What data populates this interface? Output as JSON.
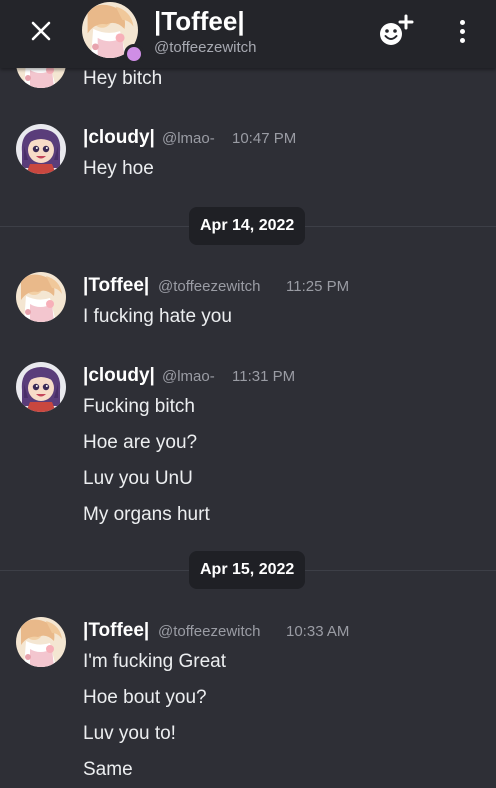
{
  "header": {
    "name": "|Toffee|",
    "handle": "@toffeezewitch",
    "status_color": "#cf8ee6",
    "icons": [
      "close-icon",
      "add-friend-icon",
      "more-vertical-icon"
    ]
  },
  "messages": [
    {
      "text": "Hey bitch"
    },
    {
      "author": "|cloudy|",
      "handle": "@lmao-",
      "time": "10:47 PM",
      "lines": [
        "Hey hoe"
      ]
    },
    {
      "date": "Apr 14, 2022"
    },
    {
      "author": "|Toffee|",
      "handle": "@toffeezewitch",
      "time": "11:25 PM",
      "lines": [
        "I fucking hate you"
      ]
    },
    {
      "author": "|cloudy|",
      "handle": "@lmao-",
      "time": "11:31 PM",
      "lines": [
        "Fucking bitch",
        "Hoe are you?",
        "Luv you UnU",
        "My organs hurt"
      ]
    },
    {
      "date": "Apr 15, 2022"
    },
    {
      "author": "|Toffee|",
      "handle": "@toffeezewitch",
      "time": "10:33 AM",
      "lines": [
        "I'm fucking Great",
        "Hoe bout you?",
        "Luv you to!",
        "Same"
      ]
    }
  ]
}
